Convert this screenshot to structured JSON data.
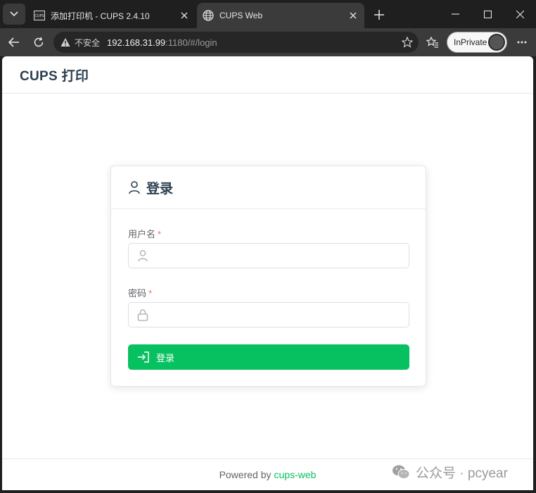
{
  "browser": {
    "tabs": [
      {
        "title": "添加打印机 - CUPS 2.4.10",
        "active": false,
        "favicon_text": "CUPS"
      },
      {
        "title": "CUPS Web",
        "active": true
      }
    ],
    "address": {
      "security_label": "不安全",
      "host": "192.168.31.99",
      "path": ":1180/#/login"
    },
    "inprivate_label": "InPrivate"
  },
  "app": {
    "title": "CUPS 打印",
    "login_card": {
      "title": "登录",
      "username": {
        "label": "用户名",
        "required_mark": "*",
        "value": "",
        "placeholder": ""
      },
      "password": {
        "label": "密码",
        "required_mark": "*",
        "value": "",
        "placeholder": ""
      },
      "submit_label": "登录"
    },
    "footer": {
      "prefix": "Powered by",
      "link": "cups-web"
    }
  },
  "watermark": {
    "text": "公众号 · pcyear"
  },
  "colors": {
    "accent": "#07c160",
    "required": "#f56c6c",
    "title": "#2c3e50",
    "border": "#dcdfe6"
  }
}
